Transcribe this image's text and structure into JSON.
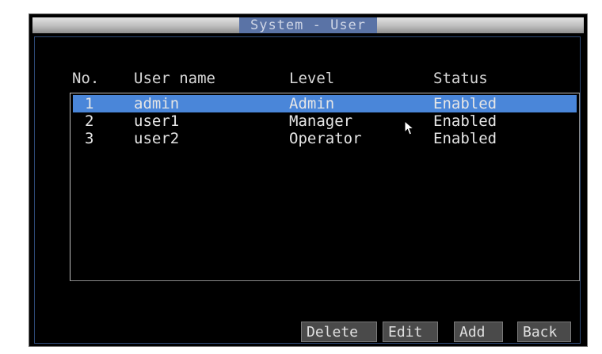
{
  "window": {
    "title": "System - User"
  },
  "table": {
    "headers": {
      "no": "No.",
      "name": "User name",
      "level": "Level",
      "status": "Status"
    },
    "rows": [
      {
        "no": "1",
        "name": "admin",
        "level": "Admin",
        "status": "Enabled",
        "selected": true
      },
      {
        "no": "2",
        "name": "user1",
        "level": "Manager",
        "status": "Enabled",
        "selected": false
      },
      {
        "no": "3",
        "name": "user2",
        "level": "Operator",
        "status": "Enabled",
        "selected": false
      }
    ]
  },
  "buttons": {
    "delete": "Delete",
    "edit": "Edit",
    "add": "Add",
    "back": "Back"
  },
  "colors": {
    "selection": "#4a86d9",
    "title_bg": "#5a73a6",
    "background": "#000000"
  },
  "icons": {
    "cursor": "mouse-pointer-icon"
  }
}
